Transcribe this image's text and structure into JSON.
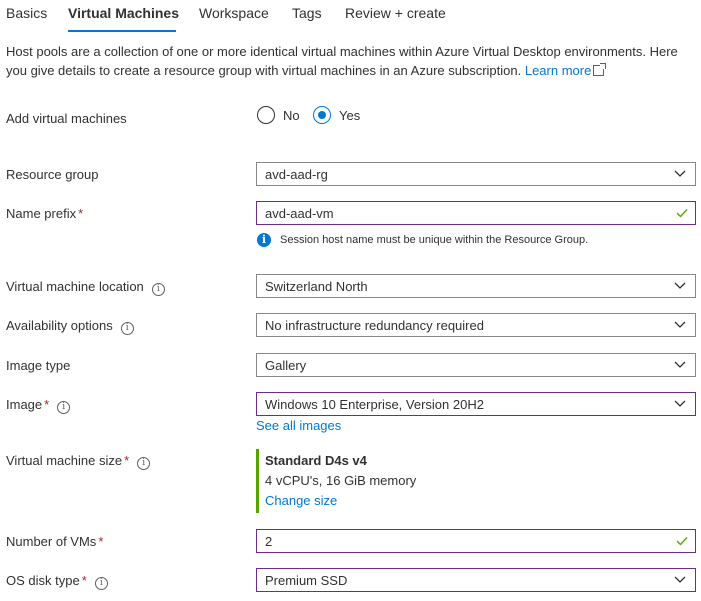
{
  "tabs": [
    {
      "label": "Basics",
      "active": false
    },
    {
      "label": "Virtual Machines",
      "active": true
    },
    {
      "label": "Workspace",
      "active": false
    },
    {
      "label": "Tags",
      "active": false
    },
    {
      "label": "Review + create",
      "active": false
    }
  ],
  "description": {
    "text": "Host pools are a collection of one or more identical virtual machines within Azure Virtual Desktop environments. Here you give details to create a resource group with virtual machines in an Azure subscription.",
    "link": "Learn more"
  },
  "add_vms": {
    "label": "Add virtual machines",
    "options": [
      "No",
      "Yes"
    ],
    "selected": "Yes"
  },
  "resource_group": {
    "label": "Resource group",
    "value": "avd-aad-rg"
  },
  "name_prefix": {
    "label": "Name prefix",
    "required": "*",
    "value": "avd-aad-vm",
    "info": "Session host name must be unique within the Resource Group."
  },
  "vm_location": {
    "label": "Virtual machine location",
    "value": "Switzerland North"
  },
  "availability": {
    "label": "Availability options",
    "value": "No infrastructure redundancy required"
  },
  "image_type": {
    "label": "Image type",
    "value": "Gallery"
  },
  "image": {
    "label": "Image",
    "required": "*",
    "value": "Windows 10 Enterprise, Version 20H2",
    "link": "See all images"
  },
  "vm_size": {
    "label": "Virtual machine size",
    "required": "*",
    "name": "Standard D4s v4",
    "detail": "4 vCPU's, 16 GiB memory",
    "link": "Change size"
  },
  "num_vms": {
    "label": "Number of VMs",
    "required": "*",
    "value": "2"
  },
  "os_disk": {
    "label": "OS disk type",
    "required": "*",
    "value": "Premium SSD"
  },
  "colors": {
    "accent": "#0078d4",
    "valid": "#57a300",
    "focus_border": "#6b2c8e",
    "required": "#a4262c"
  },
  "icons": {
    "info": "info-icon",
    "chevron": "chevron-down-icon",
    "check": "checkmark-icon",
    "external": "external-link-icon"
  }
}
